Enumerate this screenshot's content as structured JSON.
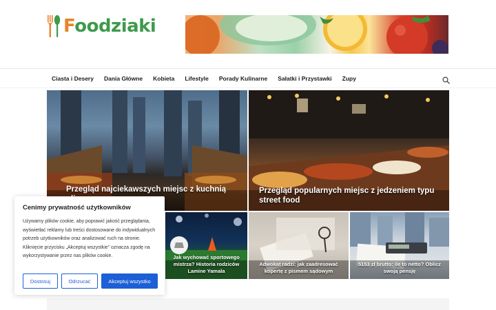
{
  "logo": {
    "first_letter": "F",
    "rest": "oodziaki"
  },
  "nav": {
    "items": [
      "Ciasta i Desery",
      "Dania Główne",
      "Kobieta",
      "Lifestyle",
      "Porady Kulinarne",
      "Sałatki i Przystawki",
      "Zupy"
    ]
  },
  "articles": [
    {
      "title": "Przegląd najciekawszych miejsc z kuchnią uliczną w"
    },
    {
      "title": "Przegląd popularnych miejsc z jedzeniem typu street food"
    },
    {
      "title": "Jak wychować sportowego mistrza? Historia rodziców Lamine Yamala"
    },
    {
      "title": "Adwokat radzi: jak zaadresować kopertę z pismem sądowym"
    },
    {
      "title": "5153 zł brutto: ile to netto? Oblicz swoją pensję"
    }
  ],
  "cookie": {
    "title": "Cenimy prywatność użytkowników",
    "body": "Używamy plików cookie, aby poprawić jakość przeglądania, wyświetlać reklamy lub treści dostosowane do indywidualnych potrzeb użytkowników oraz analizować ruch na stronie. Kliknięcie przycisku „Akceptuj wszystkie” oznacza zgodę na wykorzystywanie przez nas plików cookie.",
    "customize_label": "Dostosuj",
    "reject_label": "Odrzucać",
    "accept_label": "Akceptuj wszystko"
  },
  "colors": {
    "accent": "#1c5fd6",
    "logo_orange": "#e8832a",
    "logo_green": "#3e9a4c"
  },
  "icons": {
    "logo": "fork-spoon-icon",
    "search": "search-icon"
  }
}
